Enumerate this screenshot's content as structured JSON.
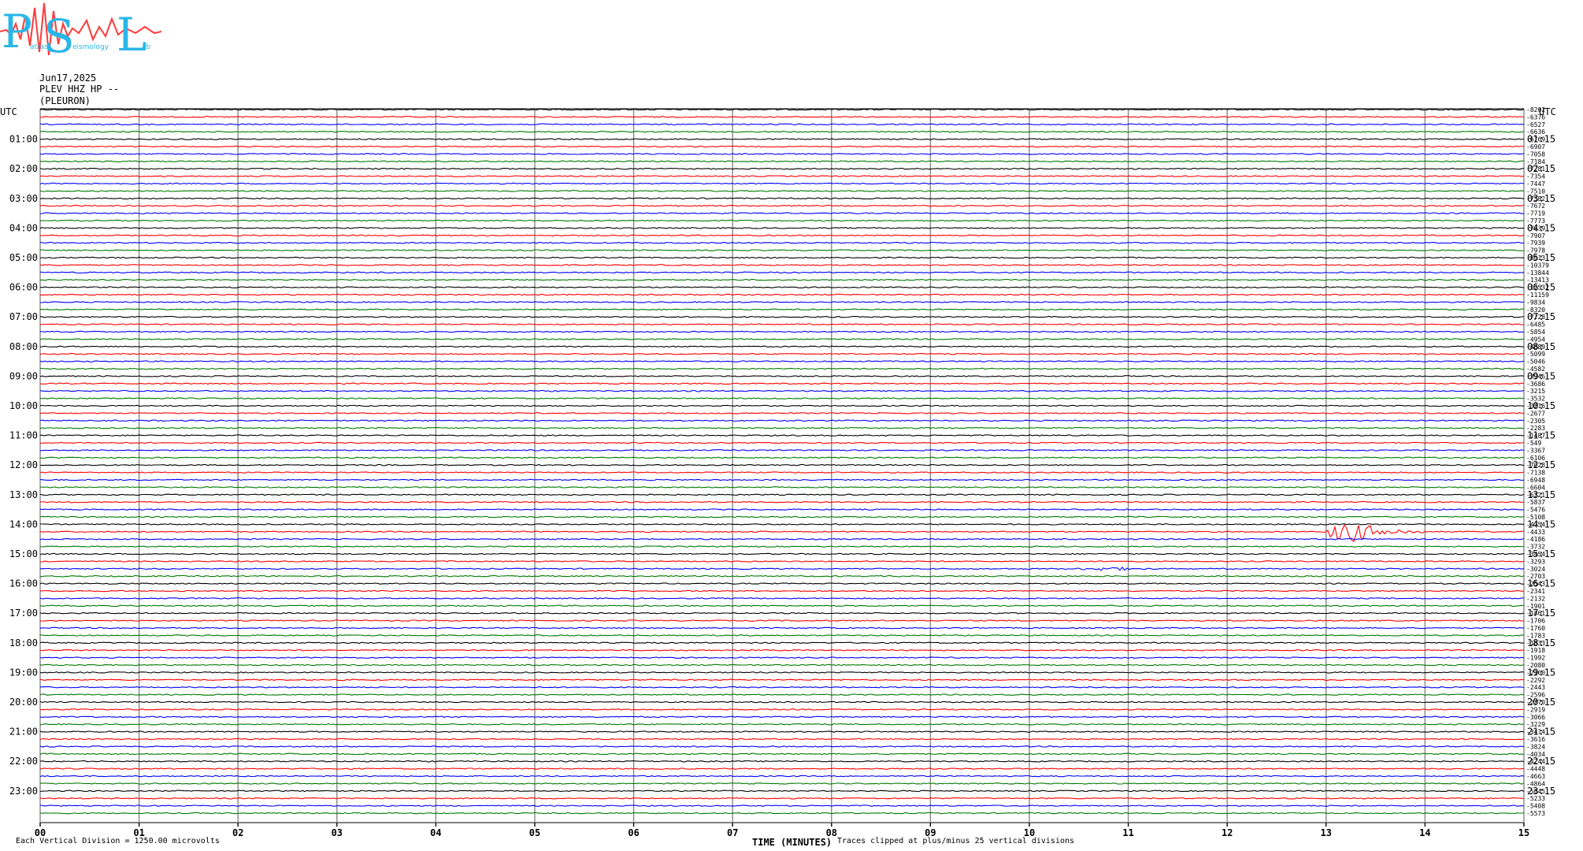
{
  "header": {
    "date": "Jun17,2025",
    "station_line": "PLEV HHZ HP --",
    "station_name": "(PLEURON)"
  },
  "logo": {
    "letters": [
      "P",
      "S",
      "L"
    ],
    "small_words": [
      "atras",
      "eismology",
      "ab"
    ],
    "colors": {
      "letters": "#29b6e8",
      "trace": "#ff3b3b"
    }
  },
  "axis": {
    "left_unit": "UTC",
    "right_unit": "UTC",
    "xlabel": "TIME (MINUTES)",
    "scale_note": "Each Vertical Division = 1250.00 microvolts",
    "clip_note": "Traces clipped at plus/minus 25 vertical divisions"
  },
  "chart_data": {
    "type": "line",
    "title": "",
    "x": [
      "00",
      "01",
      "02",
      "03",
      "04",
      "05",
      "06",
      "07",
      "08",
      "09",
      "10",
      "11",
      "12",
      "13",
      "14",
      "15"
    ],
    "xlim": [
      0,
      15
    ],
    "hour_labels_left": [
      "01:00",
      "02:00",
      "03:00",
      "04:00",
      "05:00",
      "06:00",
      "07:00",
      "08:00",
      "09:00",
      "10:00",
      "11:00",
      "12:00",
      "13:00",
      "14:00",
      "15:00",
      "16:00",
      "17:00",
      "18:00",
      "19:00",
      "20:00",
      "21:00",
      "22:00",
      "23:00"
    ],
    "hour_labels_right": [
      "01:15",
      "02:15",
      "03:15",
      "04:15",
      "05:15",
      "06:15",
      "07:15",
      "08:15",
      "09:15",
      "10:15",
      "11:15",
      "12:15",
      "13:15",
      "14:15",
      "15:15",
      "16:15",
      "17:15",
      "18:15",
      "19:15",
      "20:15",
      "21:15",
      "22:15",
      "23:15"
    ],
    "trace_colors": [
      "#000000",
      "#ff0000",
      "#0000ff",
      "#007a00"
    ],
    "trace_count": 96,
    "right_offsets": [
      "-8202",
      "-6376",
      "-6527",
      "-6636",
      "-6769",
      "-6907",
      "-7058",
      "-7184",
      "-7281",
      "-7354",
      "-7447",
      "-7510",
      "-7582",
      "-7672",
      "-7719",
      "-7773",
      "-7839",
      "-7907",
      "-7939",
      "-7978",
      "-8013",
      "-10379",
      "-13844",
      "-13413",
      "-12532",
      "-11159",
      "-9834",
      "-8320",
      "-7228",
      "-6485",
      "-5854",
      "-4954",
      "-4889",
      "-5099",
      "-5046",
      "-4582",
      "-3946",
      "-3686",
      "-3215",
      "-3532",
      "-3216",
      "-2677",
      "-2305",
      "-2283",
      "-1487",
      "-549",
      "-3367",
      "-6106",
      "-7028",
      "-7138",
      "-6948",
      "-6604",
      "-6221",
      "-5837",
      "-5476",
      "-5108",
      "-4754",
      "-4433",
      "-4186",
      "-3732",
      "-3454",
      "-3293",
      "-3024",
      "-2703",
      "-2543",
      "-2341",
      "-2132",
      "-1901",
      "-1861",
      "-1706",
      "-1760",
      "-1783",
      "-1833",
      "-1918",
      "-1992",
      "-2080",
      "-2160",
      "-2292",
      "-2443",
      "-2596",
      "-2770",
      "-2919",
      "-3066",
      "-3229",
      "-3414",
      "-3616",
      "-3824",
      "-4034",
      "-4244",
      "-4448",
      "-4663",
      "-4864",
      "-5045",
      "-5233",
      "-5408",
      "-5573"
    ],
    "events": [
      {
        "trace": 57,
        "start_min": 13.0,
        "end_min": 14.0,
        "peak_min": 13.25,
        "note": ""
      },
      {
        "trace": 62,
        "start_min": 9.6,
        "end_min": 12.2,
        "peak_min": 10.8,
        "note": ""
      }
    ]
  }
}
